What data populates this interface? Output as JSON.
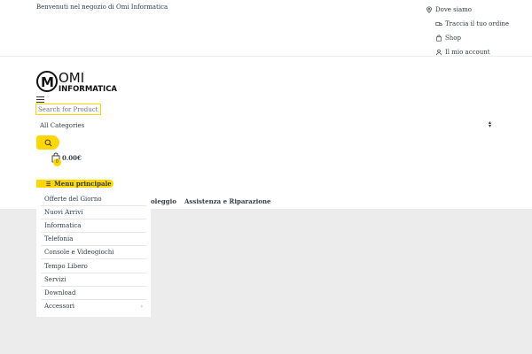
{
  "topbar": {
    "welcome": "Benvenuti nel negozio di Omi Informatica",
    "links": [
      {
        "label": "Dove siamo",
        "icon": "map-pin-icon"
      },
      {
        "label": "Traccia il tuo ordine",
        "icon": "truck-icon"
      },
      {
        "label": "Shop",
        "icon": "shopping-bag-icon"
      },
      {
        "label": "Il mio account",
        "icon": "user-icon"
      }
    ]
  },
  "logo": {
    "mark": "M",
    "line1": "OMI",
    "line2": "INFORMATICA"
  },
  "search": {
    "placeholder": "Search for Products",
    "category": "All Categories"
  },
  "cart": {
    "count": "0",
    "total": "0.00€"
  },
  "menu": {
    "label": "Menu principale",
    "items": [
      "Offerte del Giorno",
      "Nuovi Arrivi",
      "Informatica",
      "Telefonia",
      "Console e Videogiochi",
      "Tempo Libero",
      "Servizi",
      "Download",
      "Accessori"
    ]
  },
  "nav": {
    "item_partial": "oleggio",
    "item_2": "Assistenza e Riparazione"
  },
  "colors": {
    "accent": "#fed700",
    "text": "#333e48",
    "gray_bg": "#ececec"
  }
}
